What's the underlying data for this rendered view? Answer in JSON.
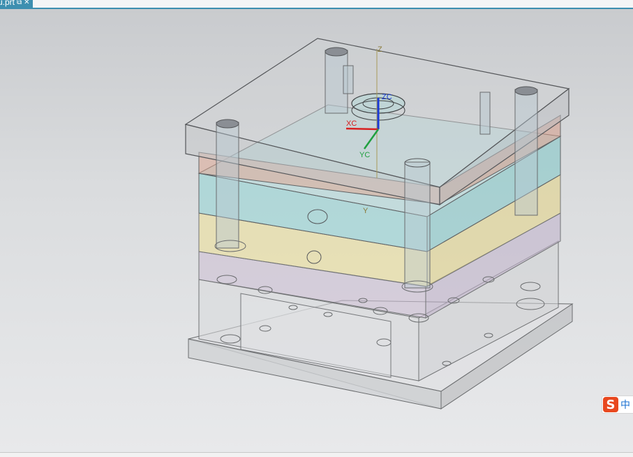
{
  "tab": {
    "name": "u.prt",
    "popout_icon": "popout-icon",
    "close_icon": "close-icon",
    "accent": "#3d8fb0"
  },
  "viewport": {
    "csys_labels": {
      "z": "Z",
      "y": "Y",
      "zc": "ZC",
      "xc": "XC",
      "yc": "YC"
    },
    "plate_colors": {
      "clamp_plate": "#c8cacc",
      "cavity_plate": "#d8a090",
      "core_cavity": "#8fd0d0",
      "support_plate": "#e8d890",
      "stripper_plate": "#c8b8d0",
      "base": "#cfd1d3"
    }
  },
  "ime": {
    "logo": "S",
    "mode": "中",
    "logo_color": "#e8481f"
  }
}
